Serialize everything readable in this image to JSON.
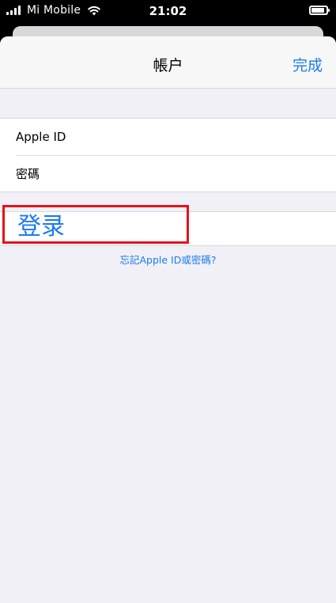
{
  "status_bar": {
    "carrier": "Mi Mobile",
    "time": "21:02",
    "signal_bars": 4,
    "battery_level": 0.9
  },
  "nav": {
    "title": "帳户",
    "done_label": "完成"
  },
  "fields": [
    {
      "label": "Apple ID"
    },
    {
      "label": "密碼"
    }
  ],
  "login_label": "登录",
  "forgot_link": "忘記Apple ID或密碼?",
  "colors": {
    "accent": "#1b7bf0",
    "highlight": "#e3121c",
    "background": "#f1f0f6"
  },
  "icons": [
    "signal-icon",
    "wifi-icon",
    "battery-icon"
  ]
}
